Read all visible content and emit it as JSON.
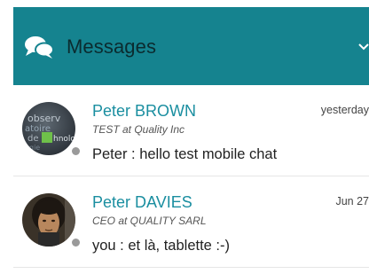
{
  "header": {
    "title": "Messages",
    "icon": "chat-bubbles-icon",
    "chevron_icon": "chevron-down-icon",
    "background_color": "#15838f"
  },
  "conversations": [
    {
      "name": "Peter BROWN",
      "role": "TEST at Quality Inc",
      "date": "yesterday",
      "preview": "Peter : hello test mobile chat",
      "presence_color": "#9a9a9a"
    },
    {
      "name": "Peter DAVIES",
      "role": "CEO at QUALITY SARL",
      "date": "Jun 27",
      "preview": "you : et là, tablette :-)",
      "presence_color": "#9a9a9a"
    }
  ]
}
